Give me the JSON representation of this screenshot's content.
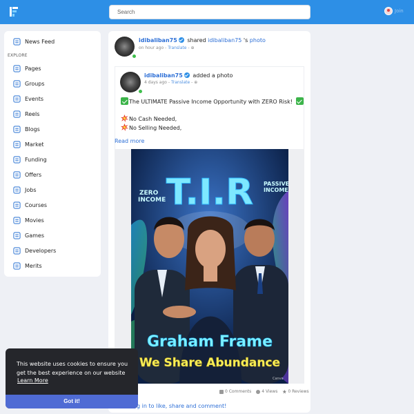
{
  "header": {
    "search_placeholder": "Search",
    "user_name": "Join",
    "brand_color": "#2d8fe6"
  },
  "sidebar": {
    "explore_label": "EXPLORE",
    "items": [
      {
        "label": "News Feed",
        "icon": "news-feed-icon"
      },
      {
        "label": "Pages",
        "icon": "flag-icon"
      },
      {
        "label": "Groups",
        "icon": "groups-icon"
      },
      {
        "label": "Events",
        "icon": "calendar-icon"
      },
      {
        "label": "Reels",
        "icon": "reels-icon"
      },
      {
        "label": "Blogs",
        "icon": "blog-icon"
      },
      {
        "label": "Market",
        "icon": "store-icon"
      },
      {
        "label": "Funding",
        "icon": "funding-icon"
      },
      {
        "label": "Offers",
        "icon": "offers-icon"
      },
      {
        "label": "Jobs",
        "icon": "briefcase-icon"
      },
      {
        "label": "Courses",
        "icon": "courses-icon"
      },
      {
        "label": "Movies",
        "icon": "movies-icon"
      },
      {
        "label": "Games",
        "icon": "gamepad-icon"
      },
      {
        "label": "Developers",
        "icon": "code-icon"
      },
      {
        "label": "Merits",
        "icon": "merits-icon"
      }
    ]
  },
  "post": {
    "author": "idibaliban75",
    "action": "shared",
    "shared_from": "idibaliban75",
    "shared_suffix": "'s",
    "shared_object": "photo",
    "time": "on hour ago",
    "translate": "Translate",
    "separator": "-",
    "shared": {
      "author": "idibaliban75",
      "action": "added a photo",
      "time": "4 days ago",
      "translate": "Translate",
      "line1": "The ULTIMATE Passive Income Opportunity with ZERO Risk!",
      "line2": "No Cash Needed,",
      "line3": "No Selling Needed,",
      "read_more": "Read more"
    },
    "image": {
      "title": "T.I.R",
      "left_tag": "ZERO INCOME",
      "right_tag": "PASSIVE INCOME",
      "name_line": "Graham Frame",
      "slogan": "We Share Abundance",
      "corner_mark": "Canva"
    },
    "stats": {
      "comments": "0 Comments",
      "views": "4 Views",
      "reviews": "0 Reviews"
    },
    "cta": "g in to like, share and comment!"
  },
  "cookie": {
    "message": "This website uses cookies to ensure you get the best experience on our website",
    "learn_more": "Learn More",
    "button": "Got it!"
  }
}
